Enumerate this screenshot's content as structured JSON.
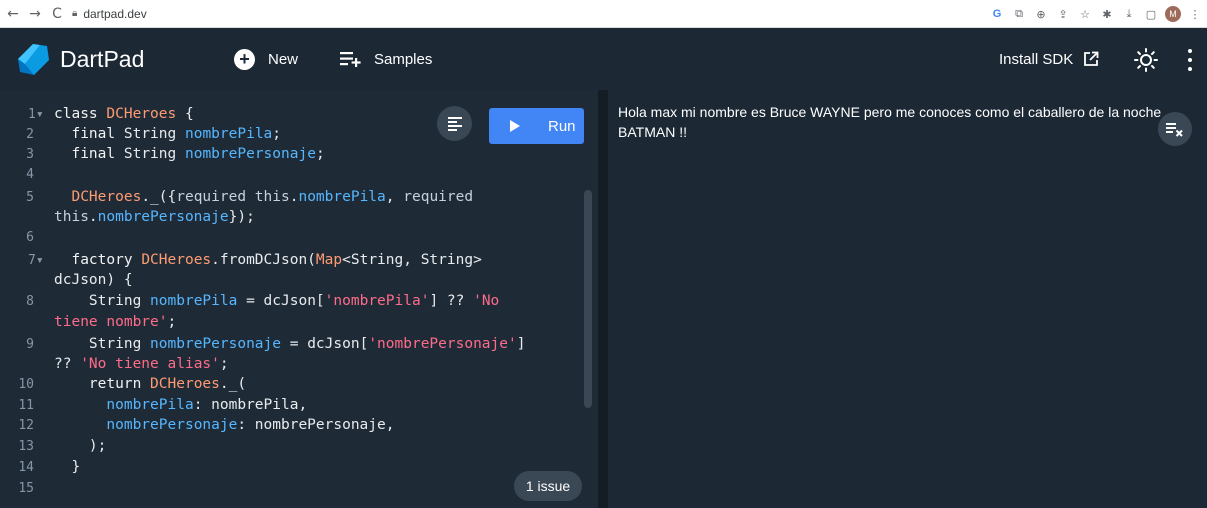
{
  "browser": {
    "back_glyph": "←",
    "forward_glyph": "→",
    "reload_glyph": "C",
    "url": "dartpad.dev",
    "avatar_initial": "M"
  },
  "header": {
    "title": "DartPad",
    "new_label": "New",
    "samples_label": "Samples",
    "install_label": "Install SDK"
  },
  "editor": {
    "lines": [
      {
        "n": "1",
        "fold": true
      },
      {
        "n": "2"
      },
      {
        "n": "3"
      },
      {
        "n": "4"
      },
      {
        "n": "5"
      },
      {
        "n": ""
      },
      {
        "n": "6"
      },
      {
        "n": "7",
        "fold": true
      },
      {
        "n": ""
      },
      {
        "n": "8"
      },
      {
        "n": ""
      },
      {
        "n": "9"
      },
      {
        "n": ""
      },
      {
        "n": "10"
      },
      {
        "n": "11"
      },
      {
        "n": "12"
      },
      {
        "n": "13"
      },
      {
        "n": "14"
      },
      {
        "n": "15"
      }
    ],
    "run_label": "Run",
    "issue_label": "1 issue"
  },
  "code": {
    "l1_kw": "class",
    "l1_cls": "DCHeroes",
    "l1_rest": " {",
    "l2_kw": "final",
    "l2_type": "String",
    "l2_fld": "nombrePila",
    "l2_rest": ";",
    "l3_kw": "final",
    "l3_type": "String",
    "l3_fld": "nombrePersonaje",
    "l3_rest": ";",
    "l5_cls": "DCHeroes",
    "l5_a": "._({",
    "l5_req1": "required this",
    "l5_dot1": ".",
    "l5_fld1": "nombrePila",
    "l5_comma": ", ",
    "l5_req2": "required",
    "l5b_this": "this",
    "l5b_dot": ".",
    "l5b_fld": "nombrePersonaje",
    "l5b_rest": "});",
    "l7_kw": "factory",
    "l7_cls": "DCHeroes",
    "l7_a": ".fromDCJson(",
    "l7_map": "Map",
    "l7_b": "<String, String>",
    "l7b": "dcJson) {",
    "l8_type": "String",
    "l8_fld": "nombrePila",
    "l8_a": " = dcJson[",
    "l8_str": "'nombrePila'",
    "l8_b": "] ?? ",
    "l8_str2": "'No",
    "l8b_str": "tiene nombre'",
    "l8b_rest": ";",
    "l9_type": "String",
    "l9_fld": "nombrePersonaje",
    "l9_a": " = dcJson[",
    "l9_str": "'nombrePersonaje'",
    "l9_b": "]",
    "l9b_a": "?? ",
    "l9b_str": "'No tiene alias'",
    "l9b_rest": ";",
    "l10_kw": "return",
    "l10_cls": "DCHeroes",
    "l10_rest": "._(",
    "l11_fld": "nombrePila",
    "l11_rest": ": nombrePila,",
    "l12_fld": "nombrePersonaje",
    "l12_rest": ": nombrePersonaje,",
    "l13": ");",
    "l14": "}"
  },
  "console": {
    "output": "Hola max mi nombre es Bruce WAYNE pero me conoces como el caballero de la noche BATMAN !!"
  },
  "colors": {
    "header_bg": "#1c2834",
    "editor_bg": "#1e2b36",
    "accent_blue": "#4285f4",
    "class_orange": "#ff9b73",
    "field_blue": "#56b6ff",
    "string_pink": "#ff6b8a"
  },
  "icons": {
    "logo": "dart-logo-icon",
    "new": "plus-circle-icon",
    "samples": "playlist-add-icon",
    "install": "open-in-new-icon",
    "theme": "brightness-icon",
    "more": "more-vert-icon",
    "format": "format-align-icon",
    "clear": "clear-all-icon"
  }
}
